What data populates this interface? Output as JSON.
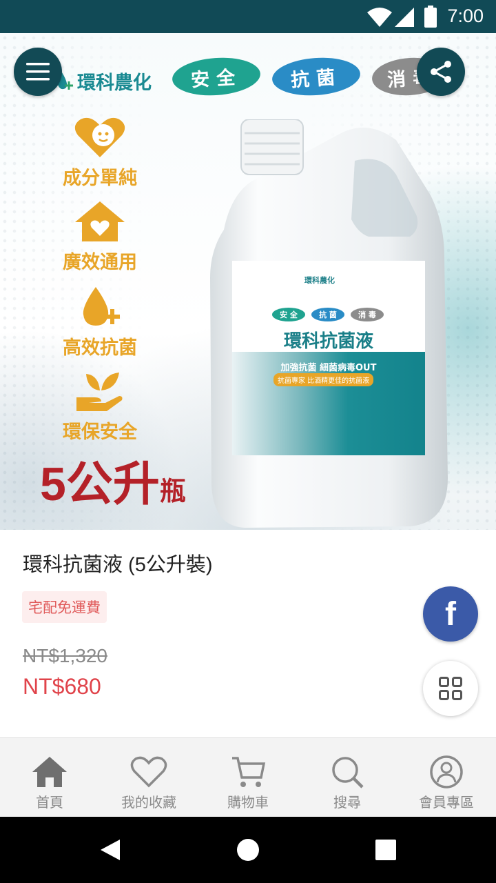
{
  "status_bar": {
    "time": "7:00"
  },
  "hero": {
    "brand": "環科農化",
    "pills": [
      {
        "label": "安全",
        "color": "#1fa390"
      },
      {
        "label": "抗菌",
        "color": "#2a8cc6"
      },
      {
        "label": "消毒",
        "color": "#8c8c8c"
      }
    ],
    "features": [
      {
        "label": "成分單純",
        "icon": "baby-heart-icon"
      },
      {
        "label": "廣效通用",
        "icon": "house-heart-icon"
      },
      {
        "label": "高效抗菌",
        "icon": "droplet-plus-icon"
      },
      {
        "label": "環保安全",
        "icon": "hand-leaf-icon"
      }
    ],
    "volume_num": "5公升",
    "volume_unit": "瓶",
    "label": {
      "brand": "環科農化",
      "pills": [
        "安 全",
        "抗 菌",
        "消 毒"
      ],
      "title": "環科抗菌液",
      "subtitle": "加強抗菌 細菌病毒OUT",
      "tagline": "抗菌專家 比酒精更佳的抗菌液"
    }
  },
  "product": {
    "title": "環科抗菌液 (5公升裝)",
    "badge": "宅配免運費",
    "price_original": "NT$1,320",
    "price_sale": "NT$680"
  },
  "floating": {
    "facebook_label": "f"
  },
  "bottom_nav": [
    {
      "label": "首頁",
      "icon": "home-icon"
    },
    {
      "label": "我的收藏",
      "icon": "heart-icon"
    },
    {
      "label": "購物車",
      "icon": "cart-icon"
    },
    {
      "label": "搜尋",
      "icon": "search-icon"
    },
    {
      "label": "會員專區",
      "icon": "user-icon"
    }
  ],
  "colors": {
    "status_bar": "#114a56",
    "feature": "#e8a528",
    "volume": "#b42128",
    "sale_price": "#e0434a",
    "facebook": "#3b5aa8"
  }
}
